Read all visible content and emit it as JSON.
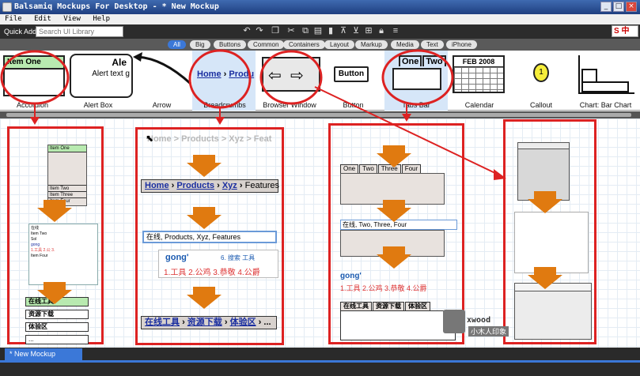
{
  "window": {
    "title": "Balsamiq Mockups For Desktop - * New Mockup",
    "minimize": "_",
    "maximize": "□",
    "close": "×"
  },
  "menu": [
    "File",
    "Edit",
    "View",
    "Help"
  ],
  "toolbar": {
    "quick_add_label": "Quick Add:",
    "search_placeholder": "Search UI Library",
    "ime_indicator": "S 中"
  },
  "filters": [
    "All",
    "Big",
    "Buttons",
    "Common",
    "Containers",
    "Layout",
    "Markup",
    "Media",
    "Text",
    "iPhone"
  ],
  "filters_active": "All",
  "library": {
    "items": [
      "Accordion",
      "Alert Box",
      "Arrow",
      "Breadcrumbs",
      "Browser Window",
      "Button",
      "Tabs Bar",
      "Calendar",
      "Callout",
      "Chart: Bar Chart"
    ],
    "accordion_text": "Item One",
    "alert_title": "Ale",
    "alert_text": "Alert text g",
    "breadcrumb_home": "Home",
    "breadcrumb_products": "Produ",
    "button_text": "Button",
    "tabs_one": "One",
    "tabs_two": "Two",
    "calendar_month": "FEB 2008",
    "callout_num": "1"
  },
  "canvas": {
    "accordion_rows": [
      "Item One",
      "Item Two",
      "Item Three",
      "Item Four"
    ],
    "accordion_text_lines": [
      "在线",
      "Item Two",
      "Sol",
      "gong",
      "1.工具 2.公 3.",
      "Item Four"
    ],
    "accordion_cn_rows": [
      "在线工具",
      "资源下载",
      "体验区",
      "..."
    ],
    "breadcrumb_ghost": "Home > Products > Xyz > Feat",
    "breadcrumb_home": "Home",
    "breadcrumb_products": "Products",
    "breadcrumb_xyz": "Xyz",
    "breadcrumb_features": "Features",
    "breadcrumb_input": "在线, Products, Xyz, Features",
    "ime_pinyin": "gong'",
    "ime_hint": "6. 搜索  工具",
    "ime_candidates": "1.工具 2.公鸡 3.恭敬 4.公爵",
    "breadcrumb_cn": [
      "在线工具",
      "资源下载",
      "体验区",
      "..."
    ],
    "tabs_labels": [
      "One",
      "Two",
      "Three",
      "Four"
    ],
    "tabs_input": "在线, Two, Three, Four",
    "tabs_ime_pinyin": "gong'",
    "tabs_ime_candidates": "1.工具 2.公鸡 3.恭敬 4.公爵",
    "tabs_cn": [
      "在线工具",
      "资源下载",
      "体验区"
    ],
    "watermark_brand": "xwood",
    "watermark_cn": "小木人印象"
  },
  "bottom_tab": "* New Mockup",
  "colors": {
    "accent_blue": "#3b78d8",
    "highlight_red": "#d22222",
    "arrow_orange": "#e07a10"
  }
}
